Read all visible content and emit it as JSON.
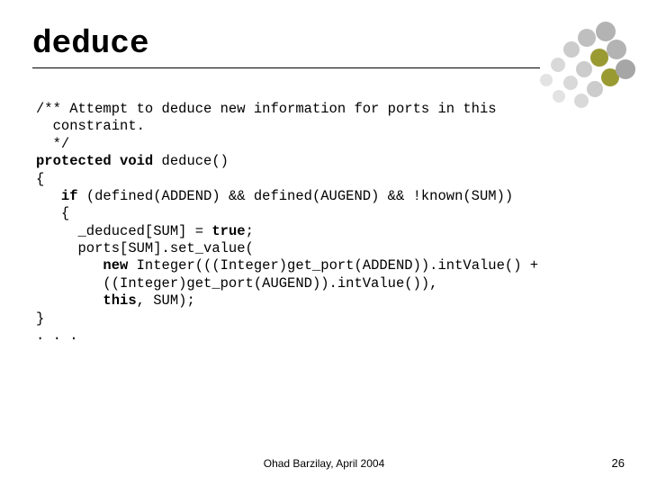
{
  "title": "deduce",
  "code": {
    "l1": "/** Attempt to deduce new information for ports in this",
    "l2": "  constraint.",
    "l3": "  */",
    "l4a": "protected void",
    "l4b": " deduce()",
    "l5": "{",
    "l6a": "   ",
    "l6b": "if",
    "l6c": " (defined(ADDEND) && defined(AUGEND) && !known(SUM))",
    "l7": "   {",
    "l8a": "     _deduced[SUM] = ",
    "l8b": "true",
    "l8c": ";",
    "l9": "     ports[SUM].set_value(",
    "l10a": "        ",
    "l10b": "new",
    "l10c": " Integer(((Integer)get_port(ADDEND)).intValue() +",
    "l11": "        ((Integer)get_port(AUGEND)).intValue()),",
    "l12a": "        ",
    "l12b": "this",
    "l12c": ", SUM);",
    "l13": "}",
    "l14": ". . ."
  },
  "footer": "Ohad Barzilay, April 2004",
  "page": "26",
  "colors": {
    "olive": "#9a9a33",
    "gray1": "#d9d9d9",
    "gray2": "#cccccc",
    "gray3": "#bfbfbf",
    "gray4": "#b3b3b3",
    "gray5": "#a6a6a6"
  }
}
